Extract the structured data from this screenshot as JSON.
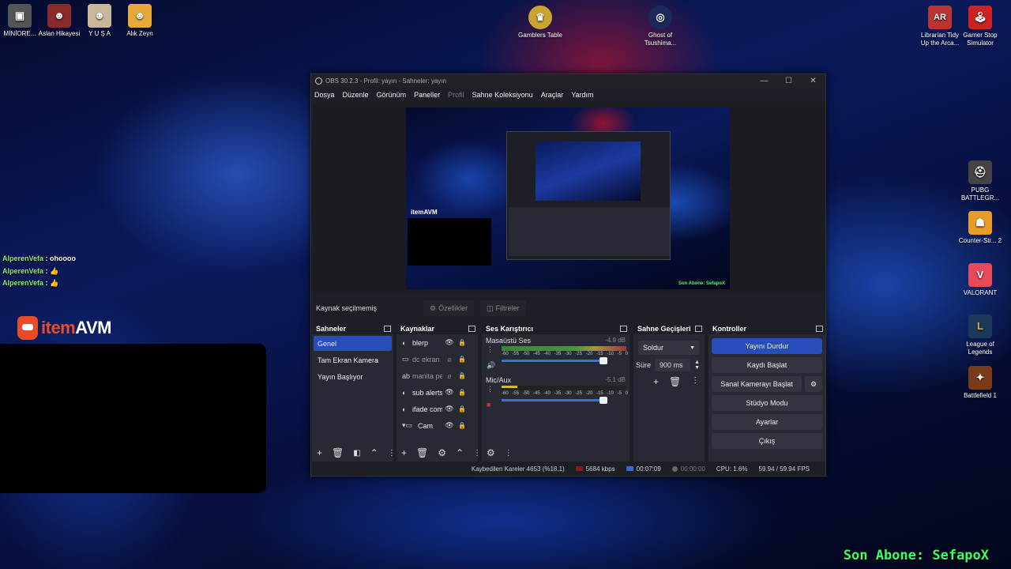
{
  "desktop": {
    "icons_left": [
      {
        "label": "MİNİORE...",
        "color": "#555"
      },
      {
        "label": "Aslan Hikayesi",
        "color": "#8a2a2a"
      },
      {
        "label": "Y U Ş A",
        "color": "#c9b79a"
      },
      {
        "label": "Alık Zeyn",
        "color": "#e6a93a"
      }
    ],
    "icons_top": [
      {
        "label": "Gamblers Table",
        "color": "#c9a431"
      },
      {
        "label": "Ghost of Tsushima...",
        "color": "#1b2a5a"
      }
    ],
    "icons_right_top": [
      {
        "label": "Librarian Tidy Up the Arca...",
        "glyph": "AR",
        "color": "#b33"
      },
      {
        "label": "Gamer Stop Simulator",
        "glyph": "🕹",
        "color": "#c22"
      }
    ],
    "icons_right": [
      {
        "label": "PUBG BATTLEGR...",
        "color": "#444"
      },
      {
        "label": "Counter-Str... 2",
        "color": "#e89b2a"
      },
      {
        "label": "VALORANT",
        "color": "#e84a5a"
      },
      {
        "label": "League of Legends",
        "color": "#1a3a5a"
      },
      {
        "label": "Battlefield 1",
        "color": "#7a3a1a"
      }
    ],
    "chat": [
      {
        "user": "AlperenVefa",
        "msg": " : ohoooo"
      },
      {
        "user": "AlperenVefa",
        "msg": " : 👍"
      },
      {
        "user": "AlperenVefa",
        "msg": " : 👍"
      }
    ],
    "brand_text_i": "item",
    "brand_text_rest": "AVM",
    "overlay_subscriber": "Son Abone: SefapoX"
  },
  "obs": {
    "title": "OBS 30.2.3 - Profil: yayın - Sahneler: yayın",
    "menu": [
      "Dosya",
      "Düzenle",
      "Görünüm",
      "Paneller",
      "Profil",
      "Sahne Koleksiyonu",
      "Araçlar",
      "Yardım"
    ],
    "no_source_selected": "Kaynak seçilmemiş",
    "properties_label": "Özellikler",
    "filters_label": "Filtreler",
    "preview_brand": "itemAVM",
    "preview_subscriber": "Son Abone: SefapoX",
    "scenes": {
      "title": "Sahneler",
      "items": [
        "Genel",
        "Tam Ekran Kamera",
        "Yayın Başlıyor"
      ],
      "active_index": 0
    },
    "sources": {
      "title": "Kaynaklar",
      "items": [
        {
          "icon": "◐",
          "name": "blerp",
          "hidden": false
        },
        {
          "icon": "▭",
          "name": "dc ekran",
          "hidden": true
        },
        {
          "icon": "ab",
          "name": "manita pe",
          "hidden": true
        },
        {
          "icon": "◐",
          "name": "sub alerts",
          "hidden": false
        },
        {
          "icon": "◐",
          "name": "ifade com",
          "hidden": false
        },
        {
          "icon": "▾▭",
          "name": "Cam",
          "hidden": false
        }
      ]
    },
    "mixer": {
      "title": "Ses Karıştırıcı",
      "channels": [
        {
          "name": "Masaüstü Ses",
          "db": "-4.9 dB",
          "level": 0.85
        },
        {
          "name": "Mic/Aux",
          "db": "-5.1 dB",
          "level": 0.85
        }
      ],
      "scale": [
        "-60",
        "-55",
        "-50",
        "-45",
        "-40",
        "-35",
        "-30",
        "-25",
        "-20",
        "-15",
        "-10",
        "-5",
        "0"
      ]
    },
    "transitions": {
      "title": "Sahne Geçişleri",
      "selected": "Soldur",
      "duration_label": "Süre",
      "duration_value": "900 ms"
    },
    "controls": {
      "title": "Kontroller",
      "stop_stream": "Yayını Durdur",
      "start_recording": "Kaydı Başlat",
      "start_virtualcam": "Sanal Kamerayı Başlat",
      "studio_mode": "Stüdyo Modu",
      "settings": "Ayarlar",
      "exit": "Çıkış"
    },
    "status": {
      "dropped_frames": "Kaybedilen Kareler 4653 (%18.1)",
      "bitrate": "5684 kbps",
      "stream_time": "00:07:09",
      "record_time": "00:00:00",
      "cpu": "CPU: 1.6%",
      "fps": "59.94 / 59.94 FPS"
    }
  }
}
